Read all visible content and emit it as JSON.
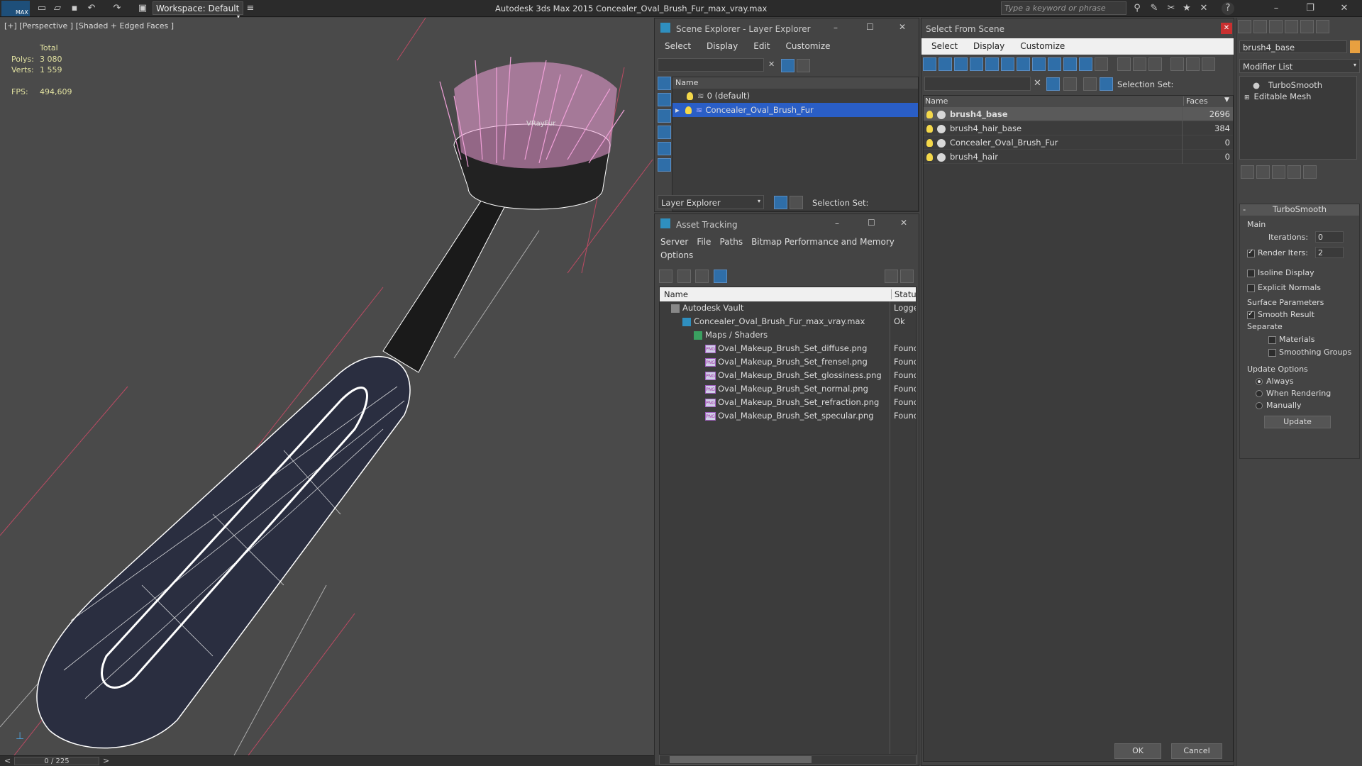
{
  "app": {
    "title": "Autodesk 3ds Max  2015    Concealer_Oval_Brush_Fur_max_vray.max",
    "logo": "MAX",
    "workspace": "Workspace: Default",
    "search_placeholder": "Type a keyword or phrase"
  },
  "viewport": {
    "label": "[+] [Perspective ] [Shaded + Edged Faces ]",
    "stats": {
      "total_label": "Total",
      "polys_label": "Polys:",
      "polys": "3 080",
      "verts_label": "Verts:",
      "verts": "1 559",
      "fps_label": "FPS:",
      "fps": "494,609"
    },
    "time": "0 / 225",
    "model_label": "VRayFur"
  },
  "scene_explorer": {
    "title": "Scene Explorer - Layer Explorer",
    "menu": [
      "Select",
      "Display",
      "Edit",
      "Customize"
    ],
    "col_name": "Name",
    "rows": [
      "0 (default)",
      "Concealer_Oval_Brush_Fur"
    ],
    "footer_mode": "Layer Explorer",
    "selection_set": "Selection Set:"
  },
  "asset_tracking": {
    "title": "Asset Tracking",
    "menu": [
      "Server",
      "File",
      "Paths",
      "Bitmap Performance and Memory",
      "Options"
    ],
    "col_name": "Name",
    "col_status": "Status",
    "rows": [
      {
        "name": "Autodesk Vault",
        "status": "Logge",
        "indent": 1,
        "icon": "vault"
      },
      {
        "name": "Concealer_Oval_Brush_Fur_max_vray.max",
        "status": "Ok",
        "indent": 2,
        "icon": "max"
      },
      {
        "name": "Maps / Shaders",
        "status": "",
        "indent": 3,
        "icon": "maps"
      },
      {
        "name": "Oval_Makeup_Brush_Set_diffuse.png",
        "status": "Found",
        "indent": 4,
        "icon": "png"
      },
      {
        "name": "Oval_Makeup_Brush_Set_frensel.png",
        "status": "Found",
        "indent": 4,
        "icon": "png"
      },
      {
        "name": "Oval_Makeup_Brush_Set_glossiness.png",
        "status": "Found",
        "indent": 4,
        "icon": "png"
      },
      {
        "name": "Oval_Makeup_Brush_Set_normal.png",
        "status": "Found",
        "indent": 4,
        "icon": "png"
      },
      {
        "name": "Oval_Makeup_Brush_Set_refraction.png",
        "status": "Found",
        "indent": 4,
        "icon": "png"
      },
      {
        "name": "Oval_Makeup_Brush_Set_specular.png",
        "status": "Found",
        "indent": 4,
        "icon": "png"
      }
    ]
  },
  "select_from_scene": {
    "title": "Select From Scene",
    "menu": [
      "Select",
      "Display",
      "Customize"
    ],
    "selection_set": "Selection Set:",
    "col_name": "Name",
    "col_faces": "Faces",
    "rows": [
      {
        "name": "brush4_base",
        "faces": "2696",
        "selected": true
      },
      {
        "name": "brush4_hair_base",
        "faces": "384",
        "selected": false
      },
      {
        "name": "Concealer_Oval_Brush_Fur",
        "faces": "0",
        "selected": false
      },
      {
        "name": "brush4_hair",
        "faces": "0",
        "selected": false
      }
    ],
    "ok": "OK",
    "cancel": "Cancel"
  },
  "command_panel": {
    "object_name": "brush4_base",
    "modifier_list": "Modifier List",
    "stack": [
      "TurboSmooth",
      "Editable Mesh"
    ],
    "rollout": "TurboSmooth",
    "main": "Main",
    "iterations_label": "Iterations:",
    "iterations": "0",
    "render_iters_label": "Render Iters:",
    "render_iters": "2",
    "isoline": "Isoline Display",
    "explicit": "Explicit Normals",
    "surface": "Surface Parameters",
    "smooth": "Smooth Result",
    "separate": "Separate",
    "materials": "Materials",
    "smoothing": "Smoothing Groups",
    "update_options": "Update Options",
    "always": "Always",
    "when_rendering": "When Rendering",
    "manually": "Manually",
    "update": "Update"
  },
  "colors": {
    "accent": "#2f6ea8",
    "fur": "#f0a0d8",
    "mesh": "#2a2e40"
  }
}
